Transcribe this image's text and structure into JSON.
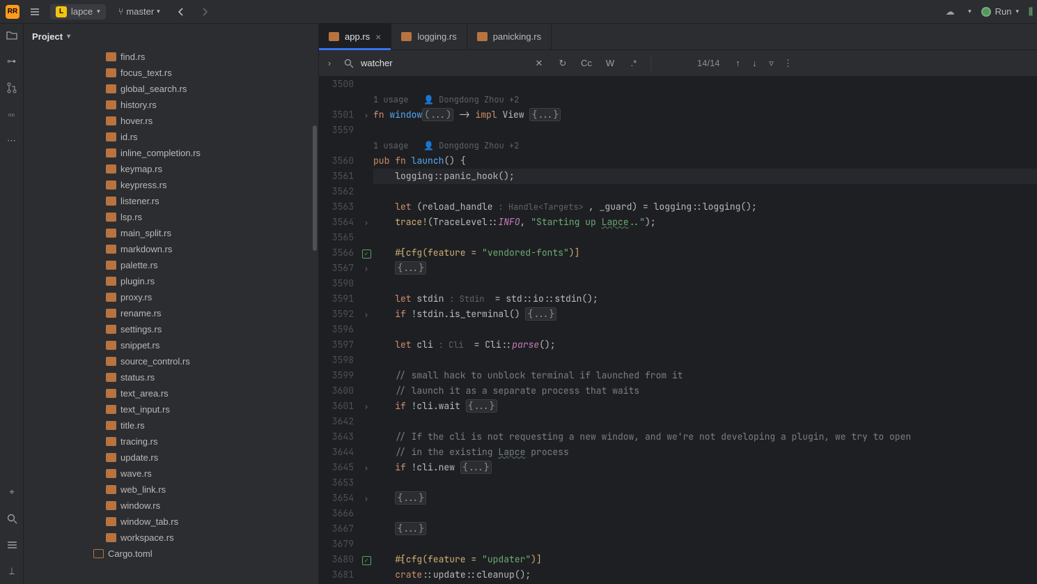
{
  "titlebar": {
    "app_icon": "RR",
    "project_icon": "L",
    "project_name": "lapce",
    "branch_icon": "⑂",
    "branch_name": "master",
    "run_label": "Run"
  },
  "sidebar": {
    "header": "Project",
    "items": [
      "find.rs",
      "focus_text.rs",
      "global_search.rs",
      "history.rs",
      "hover.rs",
      "id.rs",
      "inline_completion.rs",
      "keymap.rs",
      "keypress.rs",
      "listener.rs",
      "lsp.rs",
      "main_split.rs",
      "markdown.rs",
      "palette.rs",
      "plugin.rs",
      "proxy.rs",
      "rename.rs",
      "settings.rs",
      "snippet.rs",
      "source_control.rs",
      "status.rs",
      "text_area.rs",
      "text_input.rs",
      "title.rs",
      "tracing.rs",
      "update.rs",
      "wave.rs",
      "web_link.rs",
      "window.rs",
      "window_tab.rs",
      "workspace.rs"
    ],
    "cargo": "Cargo.toml"
  },
  "tabs": [
    {
      "label": "app.rs",
      "active": true
    },
    {
      "label": "logging.rs",
      "active": false
    },
    {
      "label": "panicking.rs",
      "active": false
    }
  ],
  "find": {
    "query": "watcher",
    "count": "14/14",
    "cc": "Cc",
    "w": "W",
    "rx": ".*"
  },
  "hints": {
    "usage1": "1 usage   ",
    "author1": "Dongdong Zhou +2",
    "usage2": "1 usage   ",
    "author2": "Dongdong Zhou +2",
    "handle_t": ": Handle<Targets> ",
    "stdin_t": ": Stdin ",
    "cli_t": ": Cli "
  },
  "code": {
    "l3500": "",
    "l3501_a": "fn",
    "l3501_b": "window",
    "l3501_c": "(...)",
    "l3501_d": " -> ",
    "l3501_e": "impl",
    "l3501_f": " View ",
    "l3501_g": "{...}",
    "l3559": "",
    "l3560_a": "pub",
    "l3560_b": "fn",
    "l3560_c": "launch",
    "l3560_d": "() {",
    "l3561": "    logging::panic_hook();",
    "l3562": "",
    "l3563_a": "    ",
    "l3563_b": "let",
    "l3563_c": " (reload_handle ",
    "l3563_d": ", _guard) = logging::logging();",
    "l3564_a": "    ",
    "l3564_b": "trace!",
    "l3564_c": "(TraceLevel::",
    "l3564_d": "INFO",
    "l3564_e": ", ",
    "l3564_f": "\"Starting up ",
    "l3564_g": "Lapce",
    "l3564_h": "..\"",
    "l3564_i": ");",
    "l3565": "",
    "l3566_a": "    ",
    "l3566_b": "#[cfg(feature = ",
    "l3566_c": "\"vendored-fonts\"",
    "l3566_d": ")]",
    "l3567": "    ",
    "l3567_f": "{...}",
    "l3590": "",
    "l3591_a": "    ",
    "l3591_b": "let",
    "l3591_c": " stdin ",
    "l3591_d": " = std::io::stdin();",
    "l3592_a": "    ",
    "l3592_b": "if",
    "l3592_c": " !stdin.is_terminal() ",
    "l3592_d": "{...}",
    "l3596": "",
    "l3597_a": "    ",
    "l3597_b": "let",
    "l3597_c": " cli ",
    "l3597_d": " = Cli::",
    "l3597_e": "parse",
    "l3597_f": "();",
    "l3598": "",
    "l3599": "    // small hack to unblock terminal if launched from it",
    "l3600": "    // launch it as a separate process that waits",
    "l3601_a": "    ",
    "l3601_b": "if",
    "l3601_c": " !cli.wait ",
    "l3601_d": "{...}",
    "l3642": "",
    "l3643": "    // If the cli is not requesting a new window, and we're not developing a plugin, we try to open",
    "l3644_a": "    // in the existing ",
    "l3644_b": "Lapce",
    "l3644_c": " process",
    "l3645_a": "    ",
    "l3645_b": "if",
    "l3645_c": " !cli.new ",
    "l3645_d": "{...}",
    "l3653": "",
    "l3654": "    ",
    "l3654_f": "{...}",
    "l3666": "",
    "l3667": "    ",
    "l3667_f": "{...}",
    "l3679": "",
    "l3680_a": "    ",
    "l3680_b": "#[cfg(feature = ",
    "l3680_c": "\"updater\"",
    "l3680_d": ")]",
    "l3681_a": "    ",
    "l3681_b": "crate",
    "l3681_c": "::update::cleanup();"
  },
  "line_numbers": [
    "3500",
    "",
    "3501",
    "3559",
    "",
    "3560",
    "3561",
    "3562",
    "3563",
    "3564",
    "3565",
    "3566",
    "3567",
    "3590",
    "3591",
    "3592",
    "3596",
    "3597",
    "3598",
    "3599",
    "3600",
    "3601",
    "3642",
    "3643",
    "3644",
    "3645",
    "3653",
    "3654",
    "3666",
    "3667",
    "3679",
    "3680",
    "3681"
  ]
}
